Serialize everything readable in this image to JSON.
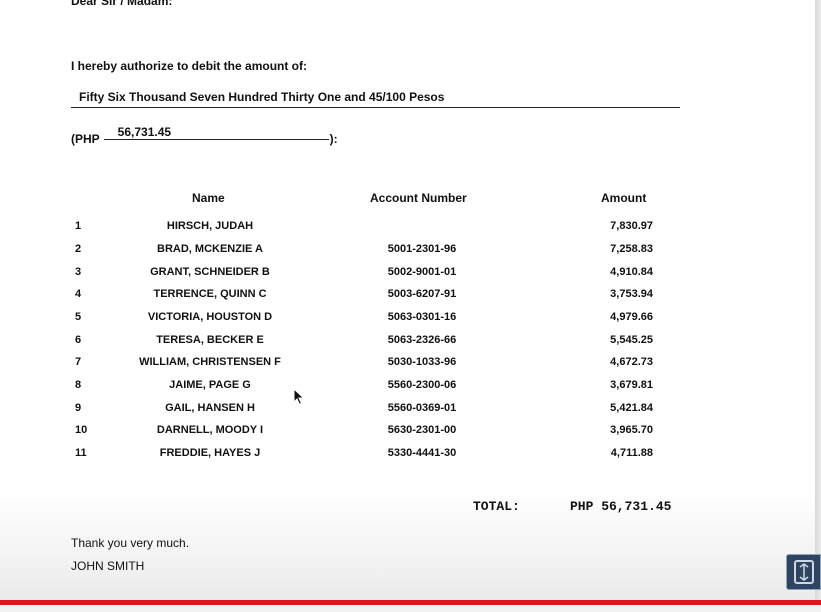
{
  "letter": {
    "salutation": "Dear Sir / Madam:",
    "authorization": "I hereby authorize to debit the amount of:",
    "amount_words": "Fifty Six Thousand Seven Hundred Thirty One and 45/100 Pesos",
    "php_prefix": "(PHP",
    "php_amount": "56,731.45",
    "php_suffix": "):",
    "thanks": "Thank you very much.",
    "signer": "JOHN SMITH"
  },
  "table": {
    "headers": {
      "name": "Name",
      "account": "Account Number",
      "amount": "Amount"
    },
    "rows": [
      {
        "num": "1",
        "name": "HIRSCH, JUDAH",
        "account": "",
        "amount": "7,830.97"
      },
      {
        "num": "2",
        "name": "BRAD, MCKENZIE A",
        "account": "5001-2301-96",
        "amount": "7,258.83"
      },
      {
        "num": "3",
        "name": "GRANT, SCHNEIDER B",
        "account": "5002-9001-01",
        "amount": "4,910.84"
      },
      {
        "num": "4",
        "name": "TERRENCE, QUINN C",
        "account": "5003-6207-91",
        "amount": "3,753.94"
      },
      {
        "num": "5",
        "name": "VICTORIA, HOUSTON D",
        "account": "5063-0301-16",
        "amount": "4,979.66"
      },
      {
        "num": "6",
        "name": "TERESA, BECKER E",
        "account": "5063-2326-66",
        "amount": "5,545.25"
      },
      {
        "num": "7",
        "name": "WILLIAM, CHRISTENSEN F",
        "account": "5030-1033-96",
        "amount": "4,672.73"
      },
      {
        "num": "8",
        "name": "JAIME, PAGE G",
        "account": "5560-2300-06",
        "amount": "3,679.81"
      },
      {
        "num": "9",
        "name": "GAIL, HANSEN H",
        "account": "5560-0369-01",
        "amount": "5,421.84"
      },
      {
        "num": "10",
        "name": "DARNELL, MOODY I",
        "account": "5630-2301-00",
        "amount": "3,965.70"
      },
      {
        "num": "11",
        "name": "FREDDIE, HAYES J",
        "account": "5330-4441-30",
        "amount": "4,711.88"
      }
    ],
    "total_label": "TOTAL:",
    "total_value": "PHP 56,731.45"
  },
  "icons": {
    "cursor": "mouse-pointer-icon",
    "expand": "expand-icon"
  },
  "colors": {
    "accent_bar": "#e0141b",
    "expand_button": "#2e4460"
  }
}
